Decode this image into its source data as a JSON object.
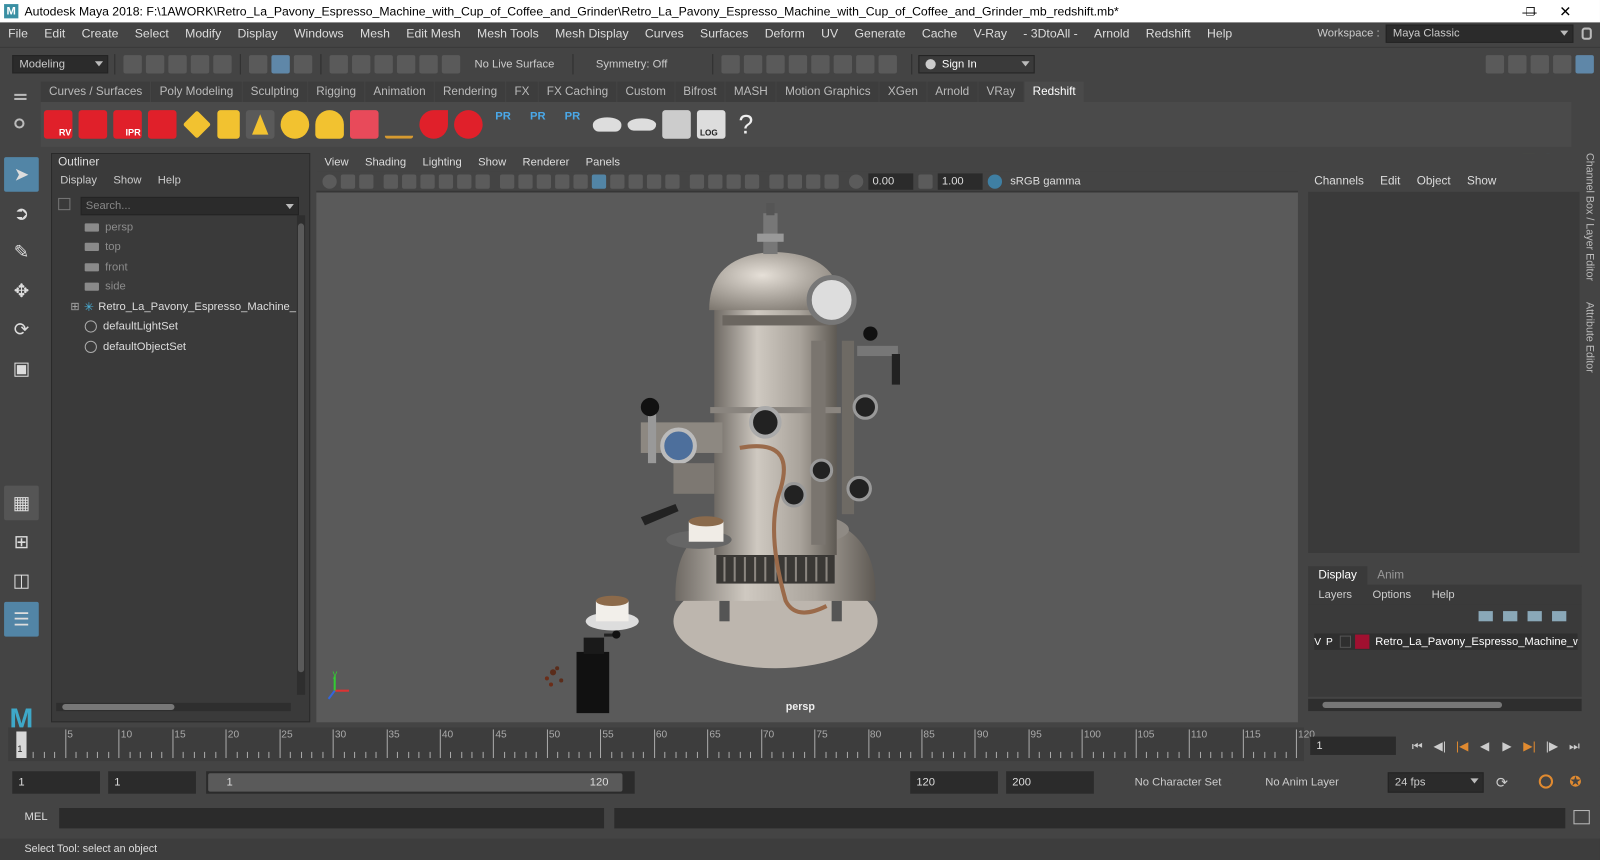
{
  "window": {
    "title": "Autodesk Maya 2018: F:\\1AWORK\\Retro_La_Pavony_Espresso_Machine_with_Cup_of_Coffee_and_Grinder\\Retro_La_Pavony_Espresso_Machine_with_Cup_of_Coffee_and_Grinder_mb_redshift.mb*",
    "logo": "M"
  },
  "menubar": {
    "items": [
      "File",
      "Edit",
      "Create",
      "Select",
      "Modify",
      "Display",
      "Windows",
      "Mesh",
      "Edit Mesh",
      "Mesh Tools",
      "Mesh Display",
      "Curves",
      "Surfaces",
      "Deform",
      "UV",
      "Generate",
      "Cache",
      "V-Ray",
      "- 3DtoAll -",
      "Arnold",
      "Redshift",
      "Help"
    ],
    "workspace_label": "Workspace :",
    "workspace_value": "Maya Classic"
  },
  "statusline": {
    "mode": "Modeling",
    "live_surface": "No Live Surface",
    "symmetry": "Symmetry: Off",
    "sign_in": "Sign In"
  },
  "shelf": {
    "tabs": [
      "Curves / Surfaces",
      "Poly Modeling",
      "Sculpting",
      "Rigging",
      "Animation",
      "Rendering",
      "FX",
      "FX Caching",
      "Custom",
      "Bifrost",
      "MASH",
      "Motion Graphics",
      "XGen",
      "Arnold",
      "VRay",
      "Redshift"
    ],
    "active": "Redshift",
    "icon_labels": {
      "rv": "RV",
      "ipr": "IPR",
      "pr": "PR",
      "log": "LOG"
    }
  },
  "outliner": {
    "title": "Outliner",
    "menu": [
      "Display",
      "Show",
      "Help"
    ],
    "search_placeholder": "Search...",
    "items": [
      {
        "label": "persp",
        "kind": "camera"
      },
      {
        "label": "top",
        "kind": "camera"
      },
      {
        "label": "front",
        "kind": "camera"
      },
      {
        "label": "side",
        "kind": "camera"
      },
      {
        "label": "Retro_La_Pavony_Espresso_Machine_",
        "kind": "group"
      },
      {
        "label": "defaultLightSet",
        "kind": "set"
      },
      {
        "label": "defaultObjectSet",
        "kind": "set"
      }
    ]
  },
  "viewport": {
    "menu": [
      "View",
      "Shading",
      "Lighting",
      "Show",
      "Renderer",
      "Panels"
    ],
    "exposure": "0.00",
    "gamma": "1.00",
    "color_space": "sRGB gamma",
    "camera_label": "persp",
    "axis_y": "y"
  },
  "channelbox": {
    "menu": [
      "Channels",
      "Edit",
      "Object",
      "Show"
    ]
  },
  "layers": {
    "tabs": [
      "Display",
      "Anim"
    ],
    "menu": [
      "Layers",
      "Options",
      "Help"
    ],
    "layer": {
      "v": "V",
      "p": "P",
      "name": "Retro_La_Pavony_Espresso_Machine_wit",
      "color": "#a01030"
    }
  },
  "side_tabs": [
    "Channel Box / Layer Editor",
    "Attribute Editor"
  ],
  "timeline": {
    "ticks": [
      "5",
      "10",
      "15",
      "20",
      "25",
      "30",
      "35",
      "40",
      "45",
      "50",
      "55",
      "60",
      "65",
      "70",
      "75",
      "80",
      "85",
      "90",
      "95",
      "100",
      "105",
      "110",
      "115",
      "120"
    ],
    "current_marker": "1",
    "current_frame": "1"
  },
  "range": {
    "start": "1",
    "playback_start": "1",
    "slider_start": "1",
    "slider_end": "120",
    "playback_end": "120",
    "end": "200",
    "character_set": "No Character Set",
    "anim_layer": "No Anim Layer",
    "fps": "24 fps"
  },
  "cmdline": {
    "label": "MEL"
  },
  "help_line": "Select Tool: select an object",
  "colors": {
    "highlight": "#5285a6",
    "redshift_red": "#e0202a",
    "panel": "#444444",
    "field": "#2b2b2b"
  }
}
